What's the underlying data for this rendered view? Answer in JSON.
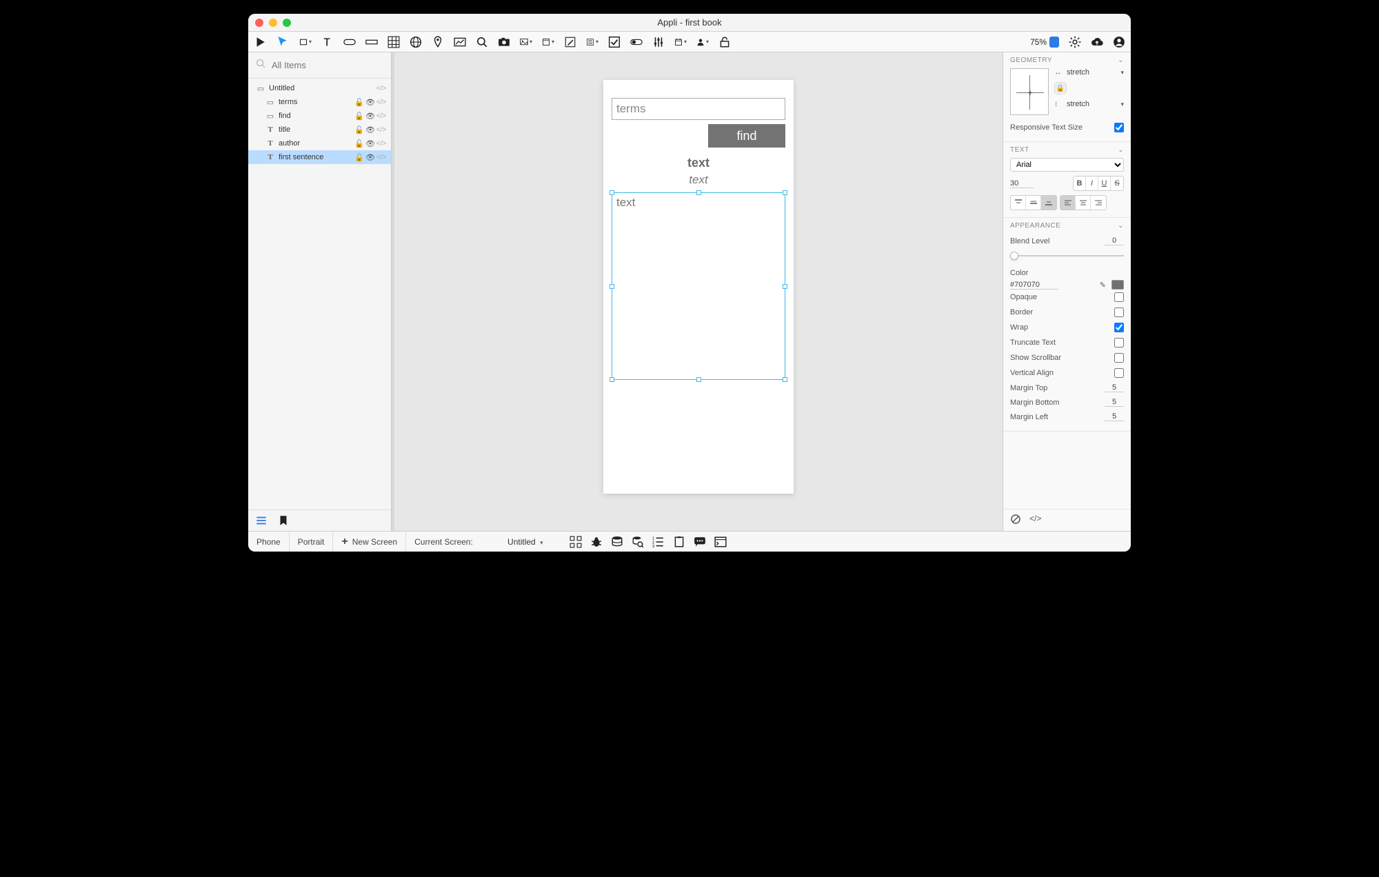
{
  "title": "Appli - first book",
  "zoom": "75%",
  "left": {
    "search_placeholder": "All Items",
    "tree": {
      "root": "Untitled",
      "items": [
        {
          "name": "terms",
          "type": "field"
        },
        {
          "name": "find",
          "type": "field"
        },
        {
          "name": "title",
          "type": "text"
        },
        {
          "name": "author",
          "type": "text"
        },
        {
          "name": "first sentence",
          "type": "text",
          "selected": true
        }
      ]
    }
  },
  "canvas": {
    "input_placeholder": "terms",
    "button_label": "find",
    "title_text": "text",
    "author_text": "text",
    "sentence_text": "text"
  },
  "inspector": {
    "geometry": {
      "header": "GEOMETRY",
      "h_mode": "stretch",
      "v_mode": "stretch",
      "responsive_label": "Responsive Text Size",
      "responsive_checked": true
    },
    "text": {
      "header": "TEXT",
      "font": "Arial",
      "size": "30"
    },
    "appearance": {
      "header": "APPEARANCE",
      "blend_label": "Blend Level",
      "blend_value": "0",
      "color_label": "Color",
      "color_value": "#707070",
      "opaque_label": "Opaque",
      "border_label": "Border",
      "wrap_label": "Wrap",
      "truncate_label": "Truncate Text",
      "scrollbar_label": "Show Scrollbar",
      "valign_label": "Vertical Align",
      "mtop_label": "Margin Top",
      "mtop_value": "5",
      "mbot_label": "Margin Bottom",
      "mbot_value": "5",
      "mleft_label": "Margin Left",
      "mleft_value": "5"
    }
  },
  "status": {
    "device": "Phone",
    "orientation": "Portrait",
    "newscreen": "New Screen",
    "current_label": "Current Screen:",
    "current_value": "Untitled"
  }
}
